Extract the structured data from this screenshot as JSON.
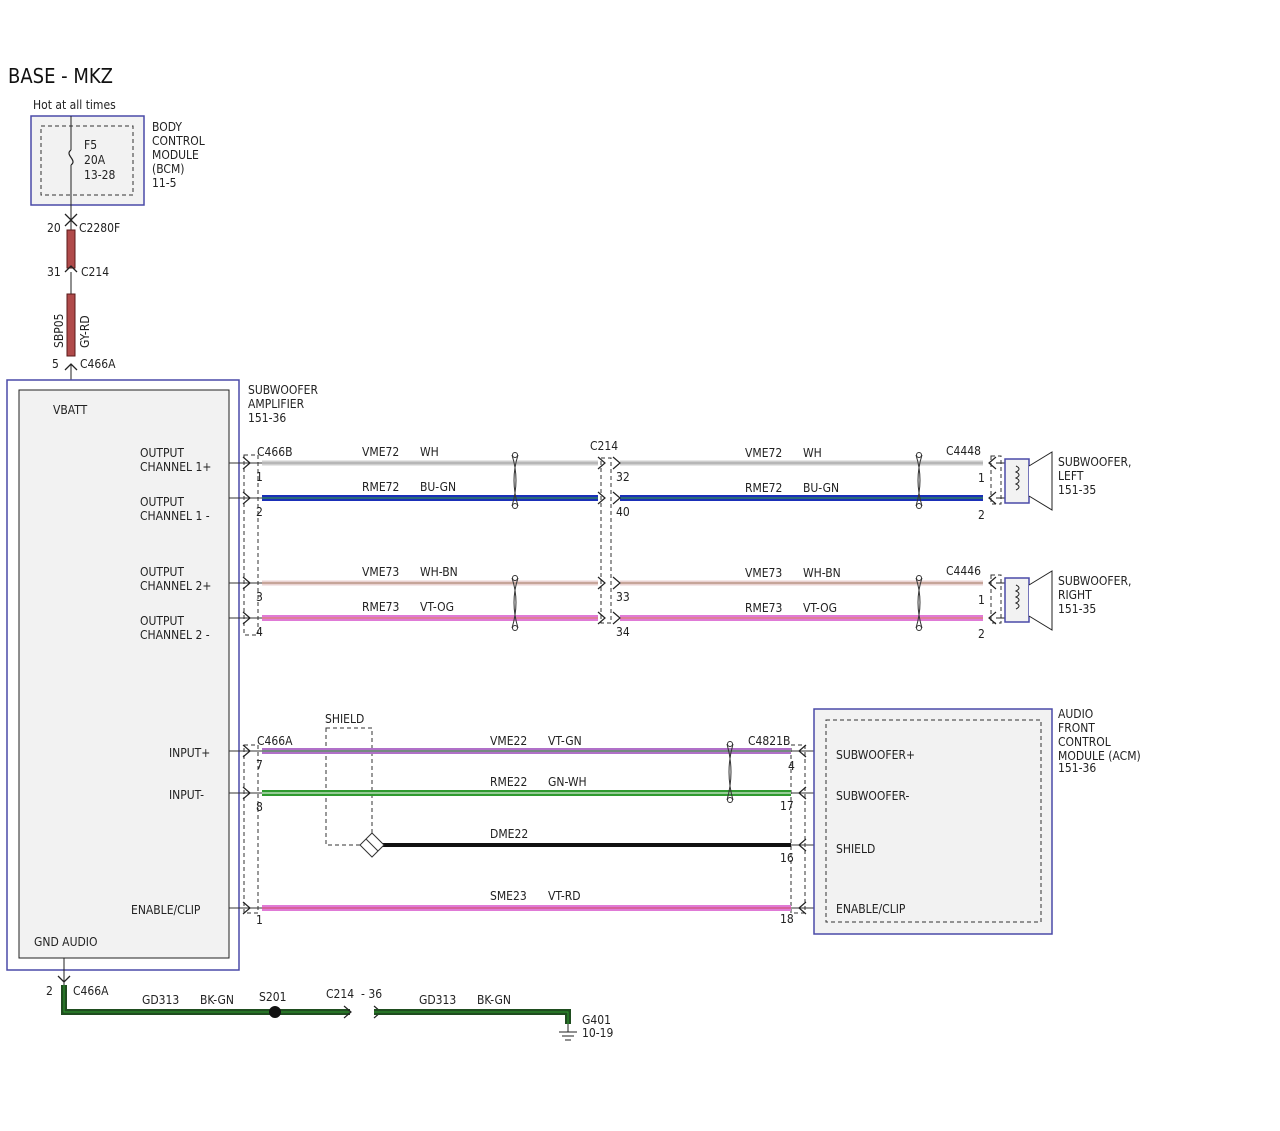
{
  "title": "BASE - MKZ",
  "hot_label": "Hot at all times",
  "fuse": {
    "name": "F5",
    "rating": "20A",
    "ref": "13-28"
  },
  "bcm": {
    "lines": [
      "BODY",
      "CONTROL",
      "MODULE",
      "(BCM)",
      "11-5"
    ]
  },
  "power_feed": {
    "pin_c2280f": "20",
    "conn_c2280f": "C2280F",
    "pin_c214": "31",
    "conn_c214": "C214",
    "circuit": "SBP05",
    "color": "GY-RD",
    "pin_c466a": "5",
    "conn_c466a": "C466A"
  },
  "amplifier": {
    "title_lines": [
      "SUBWOOFER",
      "AMPLIFIER",
      "151-36"
    ],
    "vbatt": "VBATT",
    "gnd": "GND AUDIO",
    "ch1p": [
      "OUTPUT",
      "CHANNEL 1+"
    ],
    "ch1n": [
      "OUTPUT",
      "CHANNEL 1 -"
    ],
    "ch2p": [
      "OUTPUT",
      "CHANNEL 2+"
    ],
    "ch2n": [
      "OUTPUT",
      "CHANNEL 2 -"
    ],
    "input_p": "INPUT+",
    "input_n": "INPUT-",
    "enable": "ENABLE/CLIP"
  },
  "speaker_wires": {
    "conn_left_amp": "C466B",
    "conn_mid": "C214",
    "conn_left_spk": "C4448",
    "conn_right_spk": "C4446",
    "w1": {
      "circuit": "VME72",
      "color": "WH",
      "pin_a": "1",
      "pin_m": "32",
      "pin_s": "1"
    },
    "w2": {
      "circuit": "RME72",
      "color": "BU-GN",
      "pin_a": "2",
      "pin_m": "40",
      "pin_s": "2"
    },
    "w3": {
      "circuit": "VME73",
      "color": "WH-BN",
      "pin_a": "3",
      "pin_m": "33",
      "pin_s": "1"
    },
    "w4": {
      "circuit": "RME73",
      "color": "VT-OG",
      "pin_a": "4",
      "pin_m": "34",
      "pin_s": "2"
    }
  },
  "subwoofer_left": {
    "lines": [
      "SUBWOOFER,",
      "LEFT",
      "151-35"
    ]
  },
  "subwoofer_right": {
    "lines": [
      "SUBWOOFER,",
      "RIGHT",
      "151-35"
    ]
  },
  "input_wires": {
    "conn_amp": "C466A",
    "conn_acm": "C4821B",
    "shield_label": "SHIELD",
    "w1": {
      "circuit": "VME22",
      "color": "VT-GN",
      "pin_a": "7",
      "pin_b": "4"
    },
    "w2": {
      "circuit": "RME22",
      "color": "GN-WH",
      "pin_a": "8",
      "pin_b": "17"
    },
    "w3": {
      "circuit": "DME22",
      "pin_b": "16"
    },
    "w4": {
      "circuit": "SME23",
      "color": "VT-RD",
      "pin_a": "1",
      "pin_b": "18"
    }
  },
  "acm": {
    "lines": [
      "AUDIO",
      "FRONT",
      "CONTROL",
      "MODULE (ACM)",
      "151-36"
    ],
    "pins": [
      "SUBWOOFER+",
      "SUBWOOFER-",
      "SHIELD",
      "ENABLE/CLIP"
    ]
  },
  "ground": {
    "pin": "2",
    "conn": "C466A",
    "circuit": "GD313",
    "color": "BK-GN",
    "splice": "S201",
    "conn_c214": "C214",
    "pin_c214": "- 36",
    "circuit2": "GD313",
    "color2": "BK-GN",
    "ground_point": "G401",
    "ground_ref": "10-19"
  },
  "colors": {
    "white_wire": "#dcdcdc",
    "blue_wire": "#1a2fb8",
    "whbn_wire": "#e8c4c4",
    "violet_wire": "#e07ad6",
    "vtgn_wire": "#b070c8",
    "green_wire": "#2f9a2f",
    "black_wire": "#111111",
    "ground_wire": "#1f4d1f",
    "fuse_wire": "#b04a4a",
    "module_border": "#4a4aa8"
  }
}
